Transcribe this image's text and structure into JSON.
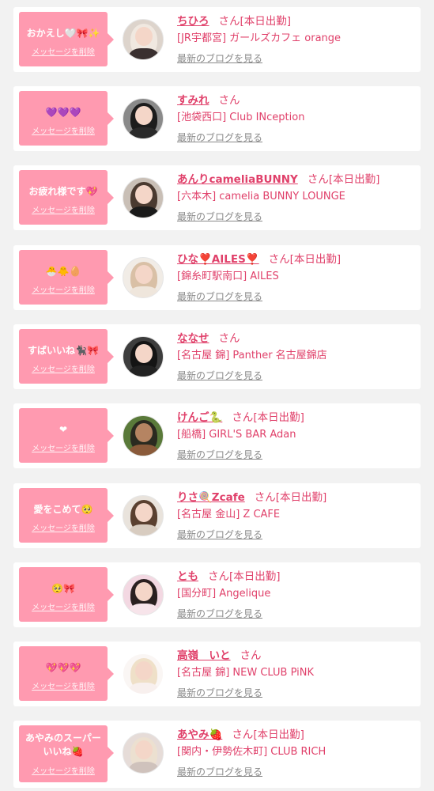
{
  "delete_label": "メッセージを削除",
  "blog_label": "最新のブログを見る",
  "san_suffix": "さん",
  "colors": {
    "accent": "#ff9ab0",
    "name_text": "#e0406a",
    "muted_text": "#8a8a8a",
    "background": "#f2f2f2",
    "card": "#ffffff"
  },
  "items": [
    {
      "message": "おかえし🤍🎀✨",
      "name": "ちひろ",
      "status": "[本日出勤]",
      "shop": "[JR宇都宮] ガールズカフェ orange"
    },
    {
      "message": "💜💜💜",
      "name": "すみれ",
      "status": "",
      "shop": "[池袋西口] Club INception"
    },
    {
      "message": "お疲れ様です💖",
      "name": "あんりcameliaBUNNY",
      "status": "[本日出勤]",
      "shop": "[六本木] camelia BUNNY LOUNGE"
    },
    {
      "message": "🐣🐥🥚",
      "name": "ひな❣️AILES❣️",
      "status": "[本日出勤]",
      "shop": "[錦糸町駅南口] AILES"
    },
    {
      "message": "すばいいね🐈‍⬛🎀",
      "name": "ななせ",
      "status": "",
      "shop": "[名古屋 錦] Panther 名古屋錦店"
    },
    {
      "message": "❤",
      "name": "けんご🐍",
      "status": "[本日出勤]",
      "shop": "[船橋] GIRL'S BAR Adan"
    },
    {
      "message": "愛をこめて🥺",
      "name": "りさ🍭Zcafe",
      "status": "[本日出勤]",
      "shop": "[名古屋 金山] Z CAFE"
    },
    {
      "message": "🥺🎀",
      "name": "とも",
      "status": "[本日出勤]",
      "shop": "[国分町] Angelique"
    },
    {
      "message": "💖💖💖",
      "name": "高嶺　いと",
      "status": "",
      "shop": "[名古屋 錦] NEW CLUB PiNK"
    },
    {
      "message": "あやみのスーパーいいね🍓",
      "name": "あやみ🍓",
      "status": "[本日出勤]",
      "shop": "[関内・伊勢佐木町] CLUB RICH"
    }
  ]
}
